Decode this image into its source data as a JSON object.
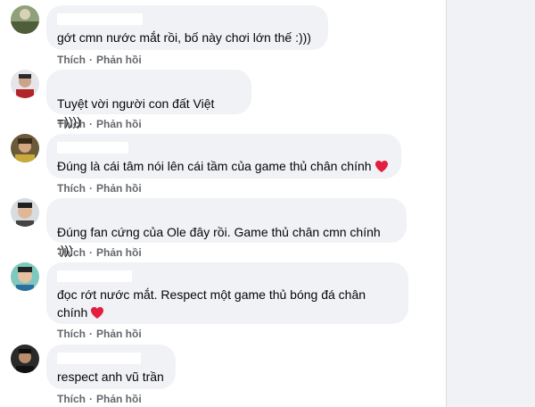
{
  "comments": [
    {
      "text": "gớt cmn nước mắt rồi, bố này chơi lớn thế :)))",
      "like": "Thích",
      "sep": "·",
      "reply": "Phản hồi"
    },
    {
      "text": "Tuyệt vời người con đất Việt =))))",
      "like": "Thích",
      "sep": "·",
      "reply": "Phản hồi"
    },
    {
      "text": "Đúng là cái tâm nói lên cái tầm của game thủ chân chính",
      "like": "Thích",
      "sep": "·",
      "reply": "Phản hồi"
    },
    {
      "text": "Đúng fan cứng của Ole đây rồi. Game thủ chân cmn chính :)))",
      "like": "Thích",
      "sep": "·",
      "reply": "Phản hồi"
    },
    {
      "text": "đọc rớt nước mắt. Respect một game thủ bóng đá chân chính",
      "like": "Thích",
      "sep": "·",
      "reply": "Phản hồi"
    },
    {
      "text": "respect anh vũ trần",
      "like": "Thích",
      "sep": "·",
      "reply": "Phản hồi"
    }
  ],
  "colors": {
    "bubble": "#f0f2f5",
    "text": "#050505",
    "action": "#65676b",
    "heart": "#e41e3f"
  }
}
